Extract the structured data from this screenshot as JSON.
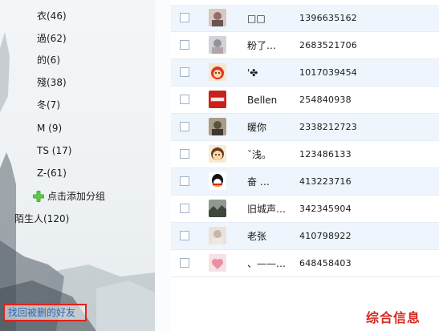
{
  "groups": [
    {
      "label": "衣(46)"
    },
    {
      "label": "過(62)"
    },
    {
      "label": "的(6)"
    },
    {
      "label": "殘(38)"
    },
    {
      "label": "冬(7)"
    },
    {
      "label": "M (9)"
    },
    {
      "label": "TS (17)"
    },
    {
      "label": "Z-(61)"
    }
  ],
  "add_group_label": "点击添加分组",
  "strangers_label": "陌生人(120)",
  "recover_link_label": "找回被删的好友",
  "friends": [
    {
      "nickname": "□□  ",
      "qq": "1396635162"
    },
    {
      "nickname": "粉了…",
      "qq": "2683521706"
    },
    {
      "nickname": "'✤",
      "qq": "1017039454"
    },
    {
      "nickname": "Bellen",
      "qq": "254840938"
    },
    {
      "nickname": "暖你",
      "qq": "2338212723"
    },
    {
      "nickname": "ˇ浅。",
      "qq": "123486133"
    },
    {
      "nickname": "奋        …",
      "qq": "413223716"
    },
    {
      "nickname": "旧城声…",
      "qq": "342345904"
    },
    {
      "nickname": "老张",
      "qq": "410798922"
    },
    {
      "nickname": "、——…",
      "qq": "648458403"
    }
  ],
  "watermark_text": "综合信息",
  "colors": {
    "accent_red": "#e0231c",
    "link_blue": "#1f6bc6",
    "row_alt": "#eef5fd"
  }
}
